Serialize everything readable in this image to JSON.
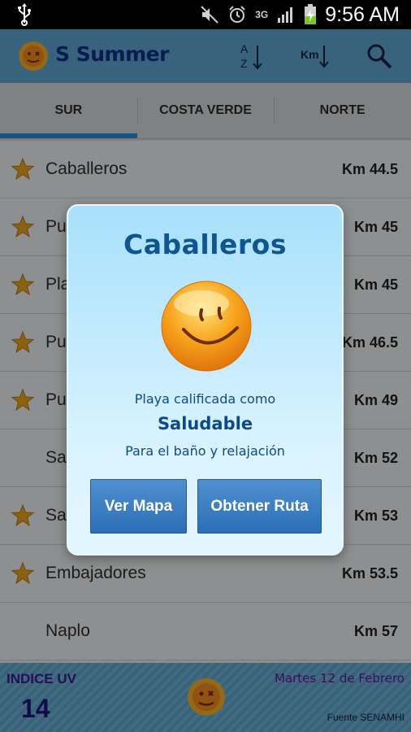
{
  "status_bar": {
    "time": "9:56 AM",
    "network": "3G",
    "icons": [
      "usb-icon",
      "mute-icon",
      "alarm-icon",
      "signal-icon",
      "battery-charging-icon"
    ]
  },
  "action_bar": {
    "app_name": "Summer",
    "logo_letter": "S",
    "sort_alpha_top": "A",
    "sort_alpha_bottom": "Z",
    "sort_km_label": "Km",
    "icons": [
      "sun-logo-icon",
      "sort-alpha-icon",
      "sort-km-icon",
      "search-icon"
    ]
  },
  "tabs": [
    {
      "label": "SUR",
      "active": true
    },
    {
      "label": "COSTA VERDE",
      "active": false
    },
    {
      "label": "NORTE",
      "active": false
    }
  ],
  "beaches": [
    {
      "name": "Caballeros",
      "km": "Km 44.5",
      "starred": true
    },
    {
      "name": "Pun",
      "km": "Km 45",
      "starred": true
    },
    {
      "name": "Pla",
      "km": "Km 45",
      "starred": true
    },
    {
      "name": "Pun",
      "km": "Km 46.5",
      "starred": true
    },
    {
      "name": "Pun",
      "km": "Km 49",
      "starred": true
    },
    {
      "name": "San",
      "km": "Km 52",
      "starred": false
    },
    {
      "name": "San",
      "km": "Km 53",
      "starred": true
    },
    {
      "name": "Embajadores",
      "km": "Km 53.5",
      "starred": true
    },
    {
      "name": "Naplo",
      "km": "Km 57",
      "starred": false
    }
  ],
  "footer": {
    "uv_label": "INDICE UV",
    "uv_value": "14",
    "date": "Martes 12 de Febrero",
    "source": "Fuente SENAMHI"
  },
  "dialog": {
    "title": "Caballeros",
    "line1": "Playa calificada como",
    "rating": "Saludable",
    "line2": "Para el baño y relajación",
    "btn_map": "Ver Mapa",
    "btn_route": "Obtener Ruta"
  },
  "colors": {
    "action_bar": "#5fa6d1",
    "tab_indicator": "#2f8bd2",
    "button_blue": "#3b7fc4",
    "dialog_title": "#0f5590",
    "uv_text": "#3c1a8e"
  }
}
